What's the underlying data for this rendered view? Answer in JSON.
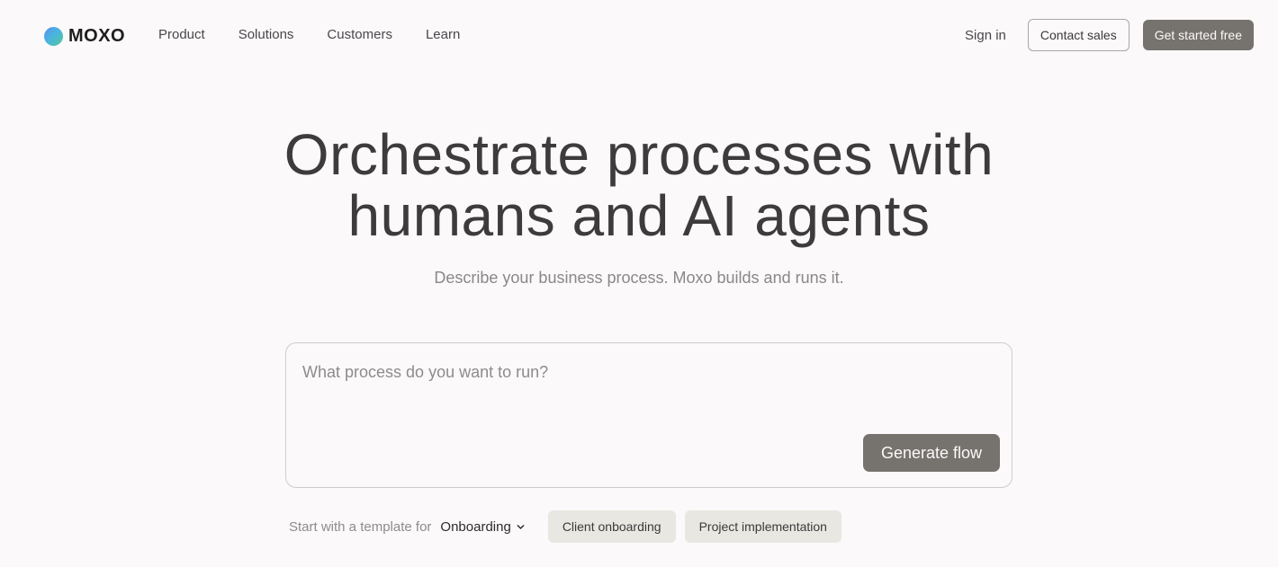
{
  "brand": {
    "name": "MOXO"
  },
  "nav": {
    "links": [
      "Product",
      "Solutions",
      "Customers",
      "Learn"
    ],
    "sign_in": "Sign in",
    "contact_sales": "Contact sales",
    "get_started": "Get started free"
  },
  "hero": {
    "title_line1": "Orchestrate processes with",
    "title_line2": "humans and AI agents",
    "subtitle": "Describe your business process. Moxo builds and runs it."
  },
  "prompt": {
    "placeholder": "What process do you want to run?",
    "value": "",
    "button": "Generate flow"
  },
  "templates": {
    "label": "Start with a template for",
    "selected": "Onboarding",
    "chips": [
      "Client onboarding",
      "Project implementation"
    ]
  },
  "colors": {
    "background": "#fbf9fa",
    "button_primary": "#76726d",
    "chip_bg": "#e9e7e2",
    "text": "#3b3a39"
  }
}
